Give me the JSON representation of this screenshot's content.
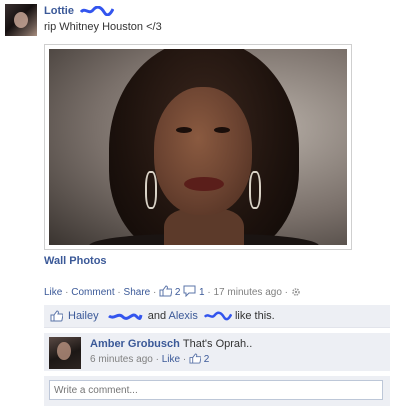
{
  "post": {
    "author": "Lottie",
    "status_text": "rip Whitney Houston </3",
    "album_link": "Wall Photos"
  },
  "actions": {
    "like_label": "Like",
    "comment_label": "Comment",
    "share_label": "Share",
    "like_count": "2",
    "comment_count": "1",
    "timestamp": "17 minutes ago",
    "separator": "·"
  },
  "likes": {
    "liker_one": "Hailey",
    "connector": "and",
    "liker_two": "Alexis",
    "suffix": "like this."
  },
  "comment": {
    "author": "Amber Grobusch",
    "text": "That's Oprah..",
    "timestamp": "6 minutes ago",
    "like_label": "Like",
    "like_count": "2"
  },
  "composer": {
    "placeholder": "Write a comment..."
  },
  "colors": {
    "link": "#3b5998",
    "scribble": "#3355ee",
    "panel_bg": "#edeff4"
  }
}
